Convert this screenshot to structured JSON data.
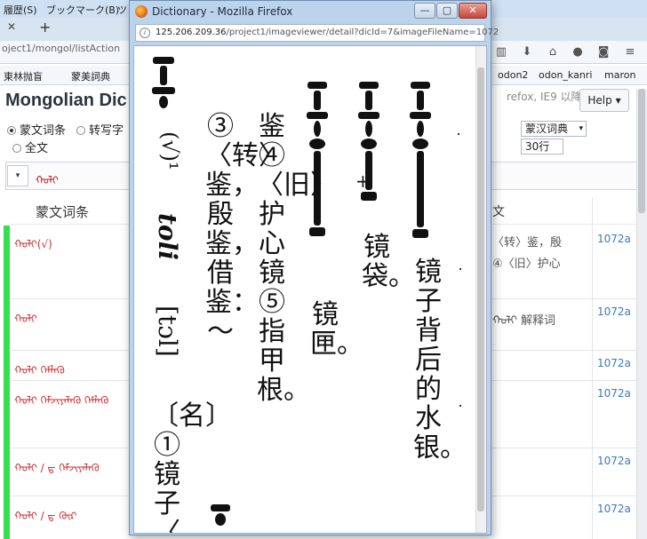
{
  "background_browser": {
    "menu": [
      "履歴(S)",
      "ブックマーク(B)",
      "ツ"
    ],
    "tab_new": "+",
    "url_partial": "oject1/mongol/listAction",
    "bookmarks": [
      "東林抛盲",
      "蒙美詞典",
      "odon2",
      "odon_kanri",
      "maron"
    ],
    "page_title": "Mongolian Dic",
    "browser_note": "refox, IE9 以降",
    "help_button": "Help ▾",
    "radio_options": [
      "蒙文词条",
      "转写字",
      "全文"
    ],
    "dict_select": "蒙汉词典",
    "rows_select": "30行",
    "search_dropdown": "▾",
    "search_value": "ᠬᠣᠯᠢ",
    "columns": {
      "left": "蒙文词条",
      "right": "文"
    },
    "rows": [
      {
        "mongol": "ᠬᠣᠯᠢ(√)",
        "translation": "〈转〉鉴，殷",
        "translation2": "④〈旧〉护心",
        "code": "1072a"
      },
      {
        "mongol": "ᠬᠣᠯᠢ",
        "translation": "ᠬᠣᠯᠢ 解释词",
        "translation2": "",
        "code": "1072a"
      },
      {
        "mongol": "ᠬᠣᠯᠢ ᠬᠡᠮᠯᠡᠬᠦ",
        "translation": "",
        "translation2": "",
        "code": "1072a"
      },
      {
        "mongol": "ᠬᠣᠯᠢ ᠬᠡᠮᠵᠢᠶᠡᠯᠡᠬᠦ ᠬᠡᠮᠯᠡᠬᠦ",
        "translation": "",
        "translation2": "",
        "code": "1072a"
      },
      {
        "mongol": "ᠬᠣᠯᠢ / ᠳ ᠬᠡᠮᠵᠢᠶᠡᠯᠡᠬᠦ",
        "translation": "",
        "translation2": "",
        "code": "1072a"
      },
      {
        "mongol": "ᠬᠣᠯᠢ / ᠳ ᠬᠦᠷ",
        "translation": "",
        "translation2": "",
        "code": "1072a"
      }
    ]
  },
  "popup": {
    "window_title": "Dictionary - Mozilla Firefox",
    "window_buttons": {
      "minimize": "—",
      "maximize": "▢",
      "close": "✕"
    },
    "url_host": "125.206.209.36",
    "url_path": "/project1/imageviewer/detail?dicId=7&imageFileName=1072",
    "scan_columns": [
      "镜子背后的水银。",
      "镜袋。",
      "镜匣。",
      "鉴④〈旧〉护心镜⑤指甲根。",
      "③〈转〉鉴，殷鉴，借鉴：～",
      "〔名〕①镜子〈",
      "[tɔl]",
      "toli"
    ],
    "headword_mark": "(√)¹"
  }
}
